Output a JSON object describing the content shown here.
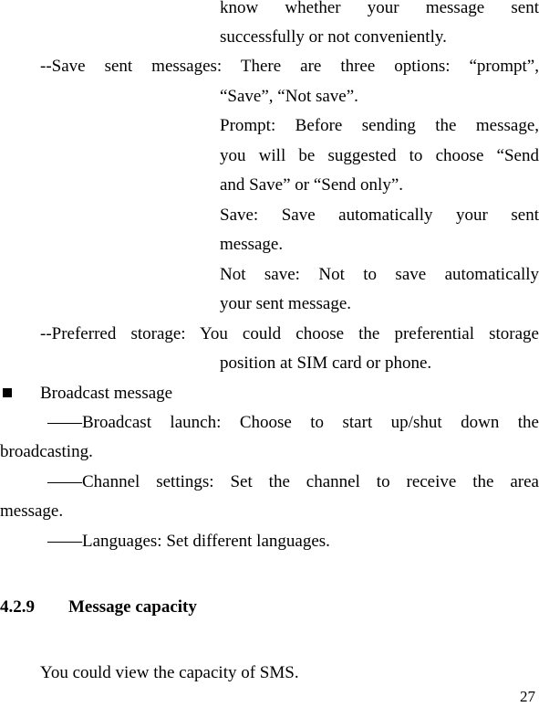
{
  "page": {
    "lines": [
      "know whether your message sent",
      "successfully or not conveniently.",
      "--Save sent messages: There are three options: “prompt”,",
      "“Save”, “Not save”.",
      "Prompt: Before sending the message,",
      "you will be suggested to choose “Send",
      "and Save” or “Send only”.",
      "Save: Save automatically your sent",
      "message.",
      "Not save: Not to save automatically",
      "your sent message.",
      "--Preferred storage: You could choose the preferential storage",
      "position at SIM card or phone."
    ],
    "broadcast": {
      "title": "Broadcast message",
      "items": [
        "——Broadcast launch: Choose to start up/shut down the",
        "broadcasting.",
        "——Channel settings: Set the channel to receive the area",
        "message.",
        "——Languages: Set different languages."
      ]
    },
    "section": {
      "number": "4.2.9",
      "title": "Message capacity"
    },
    "body_text": "You could view the capacity of SMS.",
    "page_number": "27"
  }
}
